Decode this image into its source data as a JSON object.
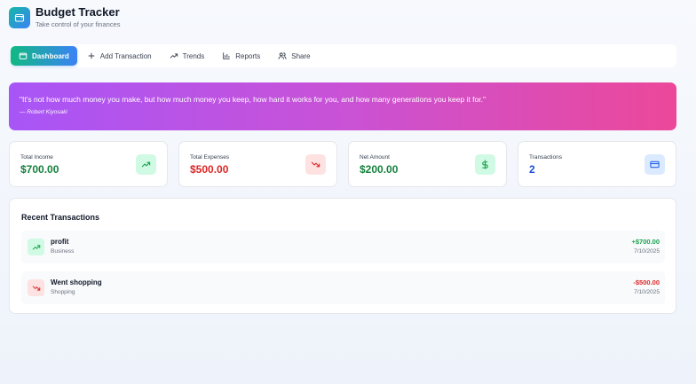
{
  "header": {
    "title": "Budget Tracker",
    "subtitle": "Take control of your finances",
    "logo_icon": "wallet-icon"
  },
  "nav": {
    "items": [
      {
        "label": "Dashboard",
        "icon": "dashboard-icon",
        "active": true
      },
      {
        "label": "Add Transaction",
        "icon": "plus-icon",
        "active": false
      },
      {
        "label": "Trends",
        "icon": "trending-icon",
        "active": false
      },
      {
        "label": "Reports",
        "icon": "bar-chart-icon",
        "active": false
      },
      {
        "label": "Share",
        "icon": "users-icon",
        "active": false
      }
    ]
  },
  "quote": {
    "text": "\"It's not how much money you make, but how much money you keep, how hard it works for you, and how many generations you keep it for.\"",
    "author": "— Robert Kiyosaki"
  },
  "stats": [
    {
      "label": "Total Income",
      "value": "$700.00",
      "color": "#15803d",
      "icon": "trending-up-icon"
    },
    {
      "label": "Total Expenses",
      "value": "$500.00",
      "color": "#dc2626",
      "icon": "trending-down-icon"
    },
    {
      "label": "Net Amount",
      "value": "$200.00",
      "color": "#15803d",
      "icon": "dollar-icon"
    },
    {
      "label": "Transactions",
      "value": "2",
      "color": "#1d4ed8",
      "icon": "credit-card-icon"
    }
  ],
  "recent": {
    "title": "Recent Transactions",
    "items": [
      {
        "title": "profit",
        "category": "Business",
        "amount": "+$700.00",
        "date": "7/10/2025",
        "type": "income"
      },
      {
        "title": "Went shopping",
        "category": "Shopping",
        "amount": "-$500.00",
        "date": "7/10/2025",
        "type": "expense"
      }
    ]
  },
  "colors": {
    "income": "#16a34a",
    "expense": "#dc2626",
    "accent": "#3b82f6"
  }
}
